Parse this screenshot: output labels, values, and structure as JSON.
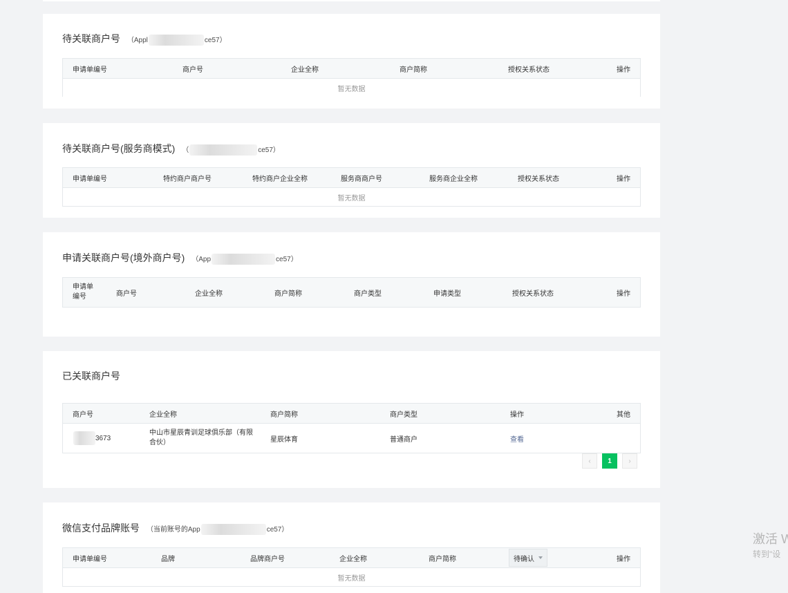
{
  "sections": {
    "s1": {
      "title": "待关联商户号",
      "appid_prefix": "（Appl",
      "appid_suffix": "ce57）",
      "columns": [
        "申请单编号",
        "商户号",
        "企业全称",
        "商户简称",
        "授权关系状态",
        "操作"
      ],
      "empty_text": "暂无数据"
    },
    "s2": {
      "title": "待关联商户号(服务商模式)",
      "appid_prefix": "（",
      "appid_suffix": "ce57）",
      "columns": [
        "申请单编号",
        "特约商户商户号",
        "特约商户企业全称",
        "服务商商户号",
        "服务商企业全称",
        "授权关系状态",
        "操作"
      ],
      "empty_text": "暂无数据"
    },
    "s3": {
      "title": "申请关联商户号(境外商户号)",
      "appid_prefix": "（App",
      "appid_suffix": "ce57）",
      "columns": [
        "申请单\n编号",
        "商户号",
        "企业全称",
        "商户简称",
        "商户类型",
        "申请类型",
        "授权关系状态",
        "操作"
      ]
    },
    "s4": {
      "title": "已关联商户号",
      "columns": [
        "商户号",
        "企业全称",
        "商户简称",
        "商户类型",
        "操作",
        "其他"
      ],
      "rows": [
        {
          "mch_id_suffix": "3673",
          "company": "中山市星辰青训足球俱乐部（有限合伙）",
          "short_name": "星辰体育",
          "type": "普通商户",
          "action": "查看",
          "other": ""
        }
      ],
      "pager": {
        "prev": "‹",
        "page": "1",
        "next": "›"
      }
    },
    "s5": {
      "title": "微信支付品牌账号",
      "appid_prefix": "（当前账号的App",
      "appid_suffix": "ce57）",
      "columns": [
        "申请单编号",
        "品牌",
        "品牌商户号",
        "企业全称",
        "商户简称",
        "待确认",
        "操作"
      ],
      "empty_text": "暂无数据"
    }
  },
  "watermark": {
    "line1": "激活 W",
    "line2": "转到\"设"
  }
}
